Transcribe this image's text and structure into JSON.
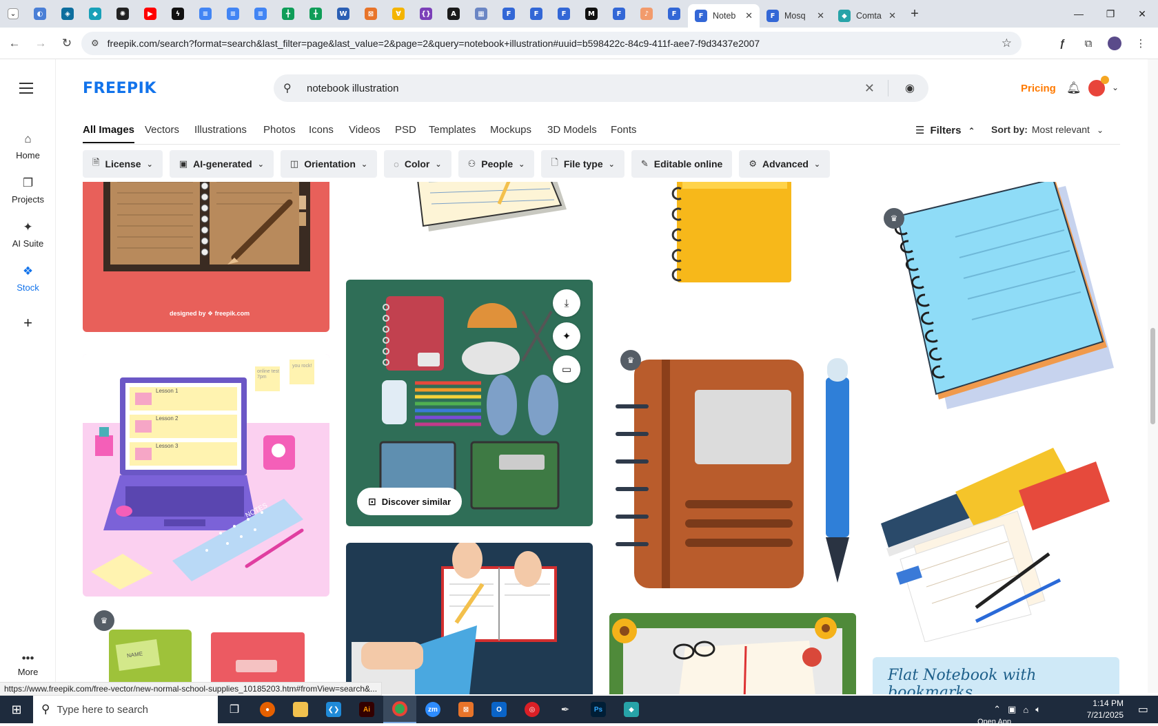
{
  "browser": {
    "pinned_favicons": [
      {
        "name": "ext-icon-1",
        "color": "#4a7fd6",
        "glyph": "◐"
      },
      {
        "name": "ext-icon-2",
        "color": "#0d6e9e",
        "glyph": "◈"
      },
      {
        "name": "ext-icon-3",
        "color": "#18a0b8",
        "glyph": "◆"
      },
      {
        "name": "chatgpt-icon",
        "color": "#222222",
        "glyph": "✺"
      },
      {
        "name": "youtube-icon",
        "color": "#ff0000",
        "glyph": "▶"
      },
      {
        "name": "bolt-icon",
        "color": "#111111",
        "glyph": "ϟ"
      },
      {
        "name": "docs-icon-1",
        "color": "#4285f4",
        "glyph": "≡"
      },
      {
        "name": "docs-icon-2",
        "color": "#4285f4",
        "glyph": "≡"
      },
      {
        "name": "docs-icon-3",
        "color": "#4285f4",
        "glyph": "≡"
      },
      {
        "name": "sheets-icon-1",
        "color": "#0f9d58",
        "glyph": "╋"
      },
      {
        "name": "sheets-icon-2",
        "color": "#0f9d58",
        "glyph": "╋"
      },
      {
        "name": "word-icon",
        "color": "#2b5fb4",
        "glyph": "W"
      },
      {
        "name": "ext-icon-orange",
        "color": "#e8742a",
        "glyph": "⊠"
      },
      {
        "name": "ext-icon-yellow",
        "color": "#f4b400",
        "glyph": "∀"
      },
      {
        "name": "brackets-icon",
        "color": "#7b3fb8",
        "glyph": "{}"
      },
      {
        "name": "ext-icon-dark",
        "color": "#1a1a1a",
        "glyph": "A"
      },
      {
        "name": "grid-icon",
        "color": "#6b86c4",
        "glyph": "▦"
      },
      {
        "name": "forms-icon-1",
        "color": "#3367d6",
        "glyph": "F"
      },
      {
        "name": "forms-icon-2",
        "color": "#3367d6",
        "glyph": "F"
      },
      {
        "name": "forms-icon-3",
        "color": "#3367d6",
        "glyph": "F"
      },
      {
        "name": "medium-icon",
        "color": "#111111",
        "glyph": "M"
      },
      {
        "name": "forms-icon-4",
        "color": "#3367d6",
        "glyph": "F"
      },
      {
        "name": "ext-icon-peach",
        "color": "#f29b6c",
        "glyph": "♪"
      },
      {
        "name": "forms-icon-5",
        "color": "#3367d6",
        "glyph": "F"
      }
    ],
    "tabs": [
      {
        "title": "Noteb",
        "active": true,
        "color": "#3367d6"
      },
      {
        "title": "Mosq",
        "active": false,
        "color": "#3367d6"
      },
      {
        "title": "Comta",
        "active": false,
        "color": "#27a3a8"
      }
    ],
    "url": "freepik.com/search?format=search&last_filter=page&last_value=2&page=2&query=notebook+illustration#uuid=b598422c-84c9-411f-aee7-f9d3437e2007"
  },
  "leftnav": {
    "items": [
      {
        "label": "Home",
        "icon": "⌂"
      },
      {
        "label": "Projects",
        "icon": "❐"
      },
      {
        "label": "AI Suite",
        "icon": "✦"
      },
      {
        "label": "Stock",
        "icon": "❖"
      }
    ],
    "add_icon": "+",
    "more_label": "More"
  },
  "header": {
    "logo": "FREEPIK",
    "search_value": "notebook illustration",
    "pricing": "Pricing"
  },
  "content_tabs": [
    "All Images",
    "Vectors",
    "Illustrations",
    "Photos",
    "Icons",
    "Videos",
    "PSD",
    "Templates",
    "Mockups",
    "3D Models",
    "Fonts"
  ],
  "filters_label": "Filters",
  "sort": {
    "label": "Sort by:",
    "value": "Most relevant"
  },
  "chips": [
    {
      "label": "License",
      "icon": "🗎"
    },
    {
      "label": "AI-generated",
      "icon": "▣"
    },
    {
      "label": "Orientation",
      "icon": "◫"
    },
    {
      "label": "Color",
      "icon": "◌"
    },
    {
      "label": "People",
      "icon": "⚇"
    },
    {
      "label": "File type",
      "icon": "🗋"
    },
    {
      "label": "Editable online",
      "icon": "✎"
    },
    {
      "label": "Advanced",
      "icon": "⚙"
    }
  ],
  "results": {
    "card1_credit": "designed by ❖ freepik.com",
    "lessons": [
      "Lesson 1",
      "Lesson 2",
      "Lesson 3"
    ],
    "sticky_note": "online test 7pm",
    "sticky_note2": "you rock!",
    "notes_label": "NOTES",
    "name_label": "NAME",
    "discover": "Discover similar",
    "banner_text": "Flat Notebook with bookmarks"
  },
  "status_url": "https://www.freepik.com/free-vector/new-normal-school-supplies_10185203.htm#fromView=search&...",
  "taskbar": {
    "search_placeholder": "Type here to search",
    "time": "1:14 PM",
    "date": "7/21/2025",
    "open_app_label": "Open App"
  }
}
